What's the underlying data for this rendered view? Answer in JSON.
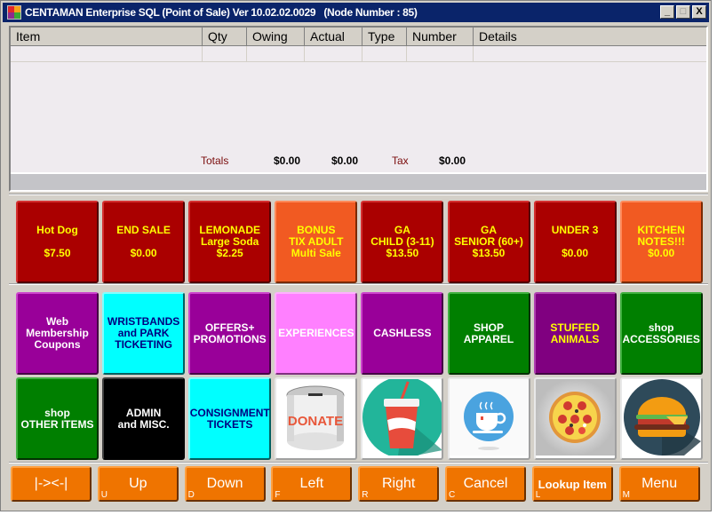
{
  "window": {
    "title": "CENTAMAN Enterprise SQL (Point of Sale) Ver 10.02.02.0029   (Node Number : 85)",
    "controls": {
      "minimize": "_",
      "maximize": "□",
      "close": "X"
    }
  },
  "grid": {
    "columns": [
      "Item",
      "Qty",
      "Owing",
      "Actual",
      "Type",
      "Number",
      "Details"
    ],
    "rows": [],
    "totals": {
      "label": "Totals",
      "owing": "$0.00",
      "actual": "$0.00",
      "tax_label": "Tax",
      "tax": "$0.00"
    }
  },
  "quick_buttons": [
    {
      "lines": [
        "Hot Dog",
        "",
        "$7.50"
      ],
      "color": "#aa0000",
      "style": "red"
    },
    {
      "lines": [
        "END SALE",
        "",
        "$0.00"
      ],
      "color": "#aa0000",
      "style": "red"
    },
    {
      "lines": [
        "LEMONADE",
        "Large Soda",
        "$2.25"
      ],
      "color": "#aa0000",
      "style": "red"
    },
    {
      "lines": [
        "BONUS",
        "TIX ADULT",
        "Multi Sale"
      ],
      "color": "#f15a22",
      "style": "orange-lite"
    },
    {
      "lines": [
        "GA",
        "CHILD (3-11)",
        "$13.50"
      ],
      "color": "#aa0000",
      "style": "red"
    },
    {
      "lines": [
        "GA",
        "SENIOR (60+)",
        "$13.50"
      ],
      "color": "#aa0000",
      "style": "red"
    },
    {
      "lines": [
        "UNDER 3",
        "",
        "$0.00"
      ],
      "color": "#aa0000",
      "style": "red"
    },
    {
      "lines": [
        "KITCHEN",
        "NOTES!!!",
        "$0.00"
      ],
      "color": "#f15a22",
      "style": "orange-lite"
    }
  ],
  "category_buttons_row1": [
    {
      "lines": [
        "Web",
        "Membership",
        "Coupons"
      ],
      "style": "purple"
    },
    {
      "lines": [
        "WRISTBANDS",
        "and PARK",
        "TICKETING"
      ],
      "style": "cyan"
    },
    {
      "lines": [
        "OFFERS+",
        "PROMOTIONS"
      ],
      "style": "purple"
    },
    {
      "lines": [
        "EXPERIENCES"
      ],
      "style": "pink"
    },
    {
      "lines": [
        "CASHLESS"
      ],
      "style": "purple"
    },
    {
      "lines": [
        "SHOP",
        "APPAREL"
      ],
      "style": "green"
    },
    {
      "lines": [
        "STUFFED",
        "ANIMALS"
      ],
      "style": "purple-dark"
    },
    {
      "lines": [
        "shop",
        "ACCESSORIES"
      ],
      "style": "green"
    }
  ],
  "category_buttons_row2": [
    {
      "lines": [
        "shop",
        "OTHER ITEMS"
      ],
      "style": "green"
    },
    {
      "lines": [
        "ADMIN",
        "and MISC."
      ],
      "style": "black"
    },
    {
      "lines": [
        "CONSIGNMENT",
        "TICKETS"
      ],
      "style": "cyan"
    },
    {
      "image": "donate-can-icon",
      "label": "DONATE"
    },
    {
      "image": "soda-cup-icon"
    },
    {
      "image": "coffee-cup-icon"
    },
    {
      "image": "pizza-icon"
    },
    {
      "image": "burger-icon"
    }
  ],
  "nav_buttons": [
    {
      "label": "|-><-|",
      "hotkey": ""
    },
    {
      "label": "Up",
      "hotkey": "U"
    },
    {
      "label": "Down",
      "hotkey": "D"
    },
    {
      "label": "Left",
      "hotkey": "F"
    },
    {
      "label": "Right",
      "hotkey": "R"
    },
    {
      "label": "Cancel",
      "hotkey": "C"
    },
    {
      "label": "Lookup Item",
      "hotkey": "L"
    },
    {
      "label": "Menu",
      "hotkey": "M"
    }
  ],
  "colors": {
    "titlebar": "#0a246a",
    "nav_button": "#ef7400",
    "price_text": "#ffff00"
  }
}
